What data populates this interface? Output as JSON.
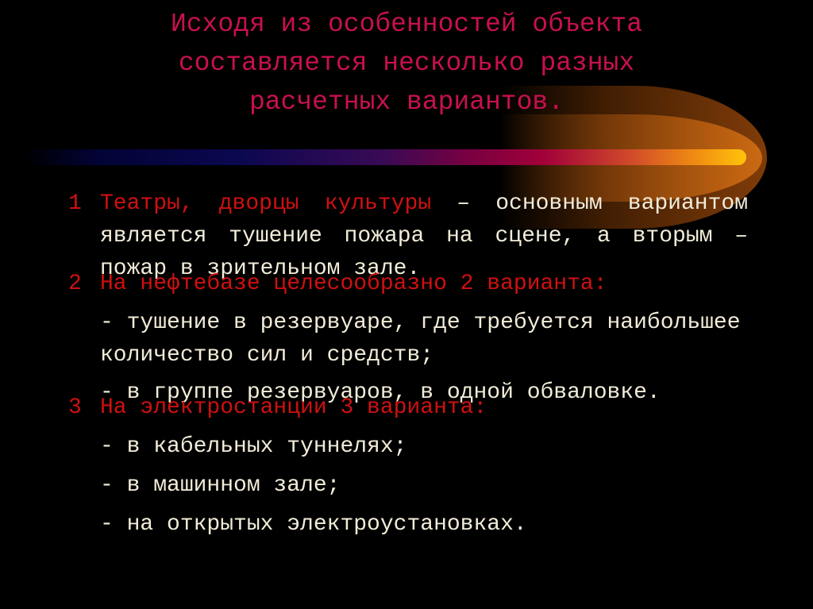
{
  "slide": {
    "title_lines": [
      "Исходя из особенностей объекта",
      "составляется несколько разных",
      "расчетных вариантов."
    ],
    "colors": {
      "background": "#000000",
      "title": "#c8104e",
      "accent_red": "#d01010",
      "body_text": "#f2ecd8"
    },
    "items": [
      {
        "number": "1",
        "lead": "Театры, дворцы культуры",
        "rest": " – основным вариантом является тушение пожара на сцене, а вторым – пожар в зрительном зале."
      },
      {
        "number": "2",
        "lead": "На нефтебазе целесообразно 2 варианта:",
        "subs": [
          "- тушение в резервуаре, где требуется наибольшее количество сил и средств;",
          "- в группе резервуаров, в одной обваловке."
        ]
      },
      {
        "number": "3",
        "lead": "На электростанции 3 варианта:",
        "subs": [
          "- в кабельных туннелях;",
          "- в машинном зале;",
          "- на открытых электроустановках."
        ]
      }
    ]
  }
}
